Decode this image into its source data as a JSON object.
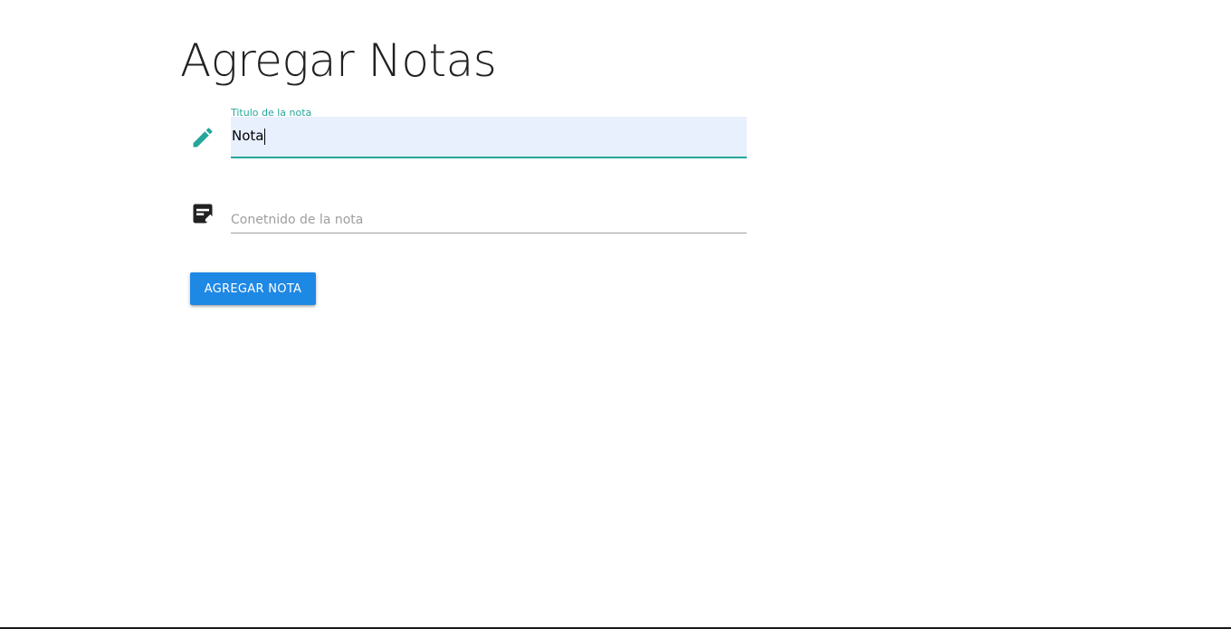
{
  "page": {
    "title": "Agregar Notas"
  },
  "form": {
    "title_field": {
      "label": "Titulo de la nota",
      "value": "Nota",
      "icon": "pencil-icon",
      "icon_color": "#26a69a",
      "focused": true
    },
    "content_field": {
      "placeholder": "Conetnido de la nota",
      "value": "",
      "icon": "note-icon",
      "icon_color": "#212121"
    },
    "submit_label": "Agregar nota"
  },
  "colors": {
    "accent": "#26a69a",
    "button": "#1e88e5",
    "input_fill": "#e8f0fe"
  }
}
